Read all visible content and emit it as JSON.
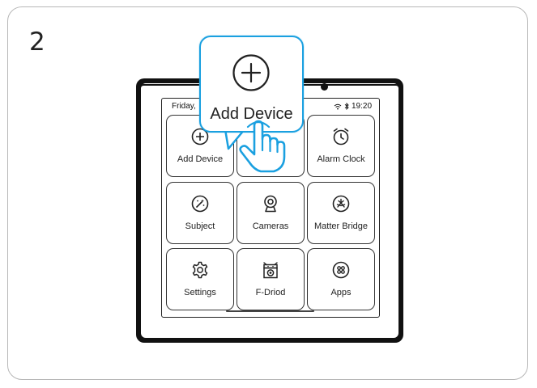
{
  "step": {
    "number": "2"
  },
  "status_bar": {
    "date": "Friday,",
    "time": "19:20",
    "icons": [
      "wifi-icon",
      "bluetooth-icon"
    ]
  },
  "popup": {
    "label": "Add Device",
    "icon": "plus-circle-icon",
    "accent": "#1aa0e0"
  },
  "tiles": [
    {
      "label": "Add Device",
      "icon": "plus-circle-icon"
    },
    {
      "label": "",
      "icon": ""
    },
    {
      "label": "Alarm Clock",
      "icon": "alarm-clock-icon"
    },
    {
      "label": "Subject",
      "icon": "magic-wand-icon"
    },
    {
      "label": "Cameras",
      "icon": "camera-icon"
    },
    {
      "label": "Matter Bridge",
      "icon": "matter-bridge-icon"
    },
    {
      "label": "Settings",
      "icon": "settings-gear-icon"
    },
    {
      "label": "F-Driod",
      "icon": "f-droid-icon"
    },
    {
      "label": "Apps",
      "icon": "apps-grid-icon"
    }
  ]
}
